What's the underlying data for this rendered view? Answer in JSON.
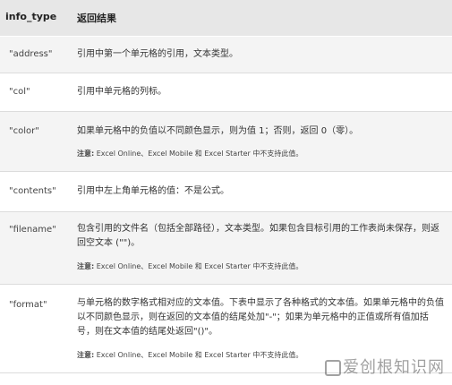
{
  "header": {
    "col1": "info_type",
    "col2": "返回结果"
  },
  "rows": [
    {
      "key": "\"address\"",
      "desc": "引用中第一个单元格的引用，文本类型。"
    },
    {
      "key": "\"col\"",
      "desc": "引用中单元格的列标。"
    },
    {
      "key": "\"color\"",
      "desc": "如果单元格中的负值以不同颜色显示，则为值 1；否则，返回 0（零）。",
      "note_label": "注意:",
      "note_text": " Excel Online、Excel Mobile 和 Excel Starter 中不支持此值。"
    },
    {
      "key": "\"contents\"",
      "desc": "引用中左上角单元格的值：不是公式。"
    },
    {
      "key": "\"filename\"",
      "desc": "包含引用的文件名（包括全部路径），文本类型。如果包含目标引用的工作表尚未保存，则返回空文本 (\"\")。",
      "note_label": "注意:",
      "note_text": " Excel Online、Excel Mobile 和 Excel Starter 中不支持此值。"
    },
    {
      "key": "\"format\"",
      "desc": "与单元格的数字格式相对应的文本值。下表中显示了各种格式的文本值。如果单元格中的负值以不同颜色显示，则在返回的文本值的结尾处加\"-\"；如果为单元格中的正值或所有值加括号，则在文本值的结尾处返回\"()\"。",
      "note_label": "注意:",
      "note_text": " Excel Online、Excel Mobile 和 Excel Starter 中不支持此值。"
    }
  ],
  "watermark": "爱创根知识网"
}
